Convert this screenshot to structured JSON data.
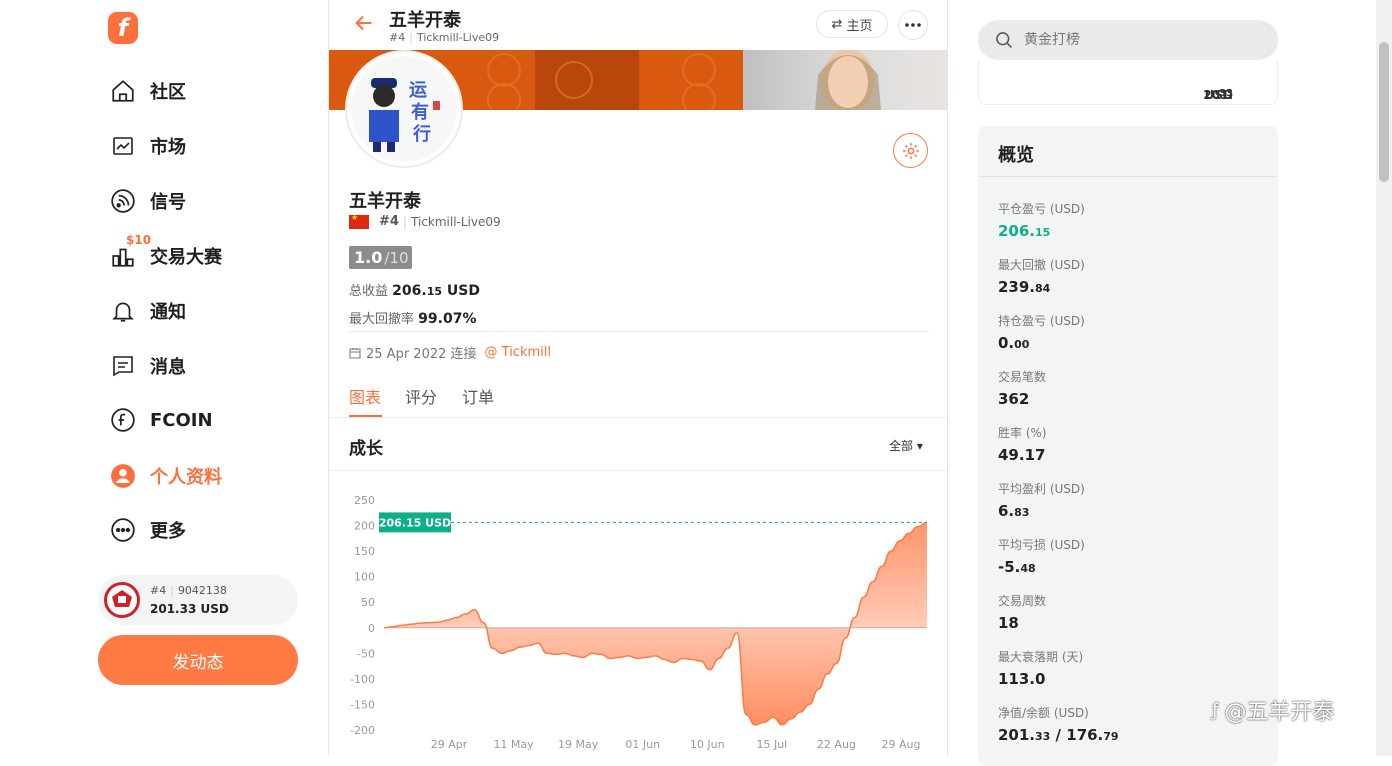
{
  "sidebar": {
    "logo": "f",
    "nav": [
      {
        "label": "社区",
        "icon": "home-icon"
      },
      {
        "label": "市场",
        "icon": "chart-line-icon"
      },
      {
        "label": "信号",
        "icon": "signal-icon"
      },
      {
        "label": "交易大赛",
        "icon": "trophy-bar-icon",
        "badge": "$10"
      },
      {
        "label": "通知",
        "icon": "bell-icon"
      },
      {
        "label": "消息",
        "icon": "message-icon"
      },
      {
        "label": "FCOIN",
        "icon": "coin-icon"
      },
      {
        "label": "个人资料",
        "icon": "user-icon",
        "active": true
      },
      {
        "label": "更多",
        "icon": "more-icon"
      }
    ],
    "account": {
      "rank": "#4",
      "id": "9042138",
      "balance": "201.33 USD"
    },
    "post_button": "发动态"
  },
  "header": {
    "title": "五羊开泰",
    "rank": "#4",
    "account": "Tickmill-Live09",
    "home_button": "主页"
  },
  "profile": {
    "name": "五羊开泰",
    "rank": "#4",
    "account": "Tickmill-Live09",
    "score": "1.0",
    "score_max": "/10",
    "total_profit_label": "总收益",
    "total_profit_int": "206.",
    "total_profit_dec": "15",
    "total_profit_unit": "USD",
    "max_drawdown_label": "最大回撤率",
    "max_drawdown": "99.07%",
    "connected": "25 Apr 2022 连接",
    "broker": "@ Tickmill"
  },
  "tabs": [
    "图表",
    "评分",
    "订单"
  ],
  "growth": {
    "title": "成长",
    "range": "全部"
  },
  "chart_data": {
    "type": "area",
    "ylim": [
      -200,
      250
    ],
    "yticks": [
      250,
      200,
      150,
      100,
      50,
      0,
      -50,
      -100,
      -150,
      -200
    ],
    "xtick_labels": [
      "29 Apr",
      "11 May",
      "19 May",
      "01 Jun",
      "10 Jun",
      "15 Jul",
      "22 Aug",
      "29 Aug"
    ],
    "series": [
      {
        "x": [
          0,
          1,
          2,
          3,
          4,
          5,
          6,
          7,
          8,
          9,
          10,
          11,
          12,
          13,
          14,
          15,
          16,
          17,
          18,
          19,
          20,
          21,
          22,
          23,
          24,
          25,
          26,
          27,
          28,
          29,
          30,
          31,
          32,
          33,
          34,
          35,
          36,
          37,
          38,
          39,
          40,
          41,
          42,
          43,
          44,
          45,
          46,
          47,
          48,
          49,
          50,
          51,
          52,
          53,
          54,
          55,
          56,
          57,
          58,
          59,
          60
        ],
        "values": [
          0,
          2,
          5,
          7,
          9,
          10,
          11,
          15,
          20,
          27,
          35,
          10,
          -40,
          -50,
          -45,
          -38,
          -35,
          -30,
          -50,
          -52,
          -50,
          -55,
          -58,
          -50,
          -52,
          -60,
          -58,
          -55,
          -60,
          -58,
          -55,
          -62,
          -68,
          -60,
          -62,
          -65,
          -82,
          -60,
          -40,
          -10,
          -170,
          -190,
          -185,
          -175,
          -190,
          -178,
          -165,
          -150,
          -120,
          -90,
          -70,
          -20,
          20,
          60,
          90,
          120,
          150,
          170,
          185,
          198,
          206.15
        ]
      }
    ],
    "last_label": "206.15 USD",
    "colors": {
      "line": "#ff7a45",
      "fill": "#ff7a45",
      "marker": "#0fae8a"
    }
  },
  "search": {
    "placeholder": "黄金打榜"
  },
  "prev_card": {
    "value_int": "201.",
    "value_dec": "33",
    "unit": "USD"
  },
  "overview": {
    "title": "概览",
    "items": [
      {
        "label": "平仓盈亏 (USD)",
        "int": "206.",
        "dec": "15",
        "green": true
      },
      {
        "label": "最大回撤 (USD)",
        "int": "239.",
        "dec": "84"
      },
      {
        "label": "持仓盈亏 (USD)",
        "int": "0.",
        "dec": "00"
      },
      {
        "label": "交易笔数",
        "int": "362",
        "dec": ""
      },
      {
        "label": "胜率 (%)",
        "int": "49.17",
        "dec": ""
      },
      {
        "label": "平均盈利 (USD)",
        "int": "6.",
        "dec": "83"
      },
      {
        "label": "平均亏损 (USD)",
        "int": "-5.",
        "dec": "48"
      },
      {
        "label": "交易周数",
        "int": "18",
        "dec": ""
      },
      {
        "label": "最大衰落期 (天)",
        "int": "113.0",
        "dec": ""
      },
      {
        "label": "净值/余额 (USD)",
        "int": "201.",
        "dec": "33",
        "extra_int": " / 176.",
        "extra_dec": "79"
      }
    ]
  },
  "watermark": "@五羊开泰",
  "colors": {
    "accent": "#ff6f3c",
    "green": "#0fae8a"
  }
}
